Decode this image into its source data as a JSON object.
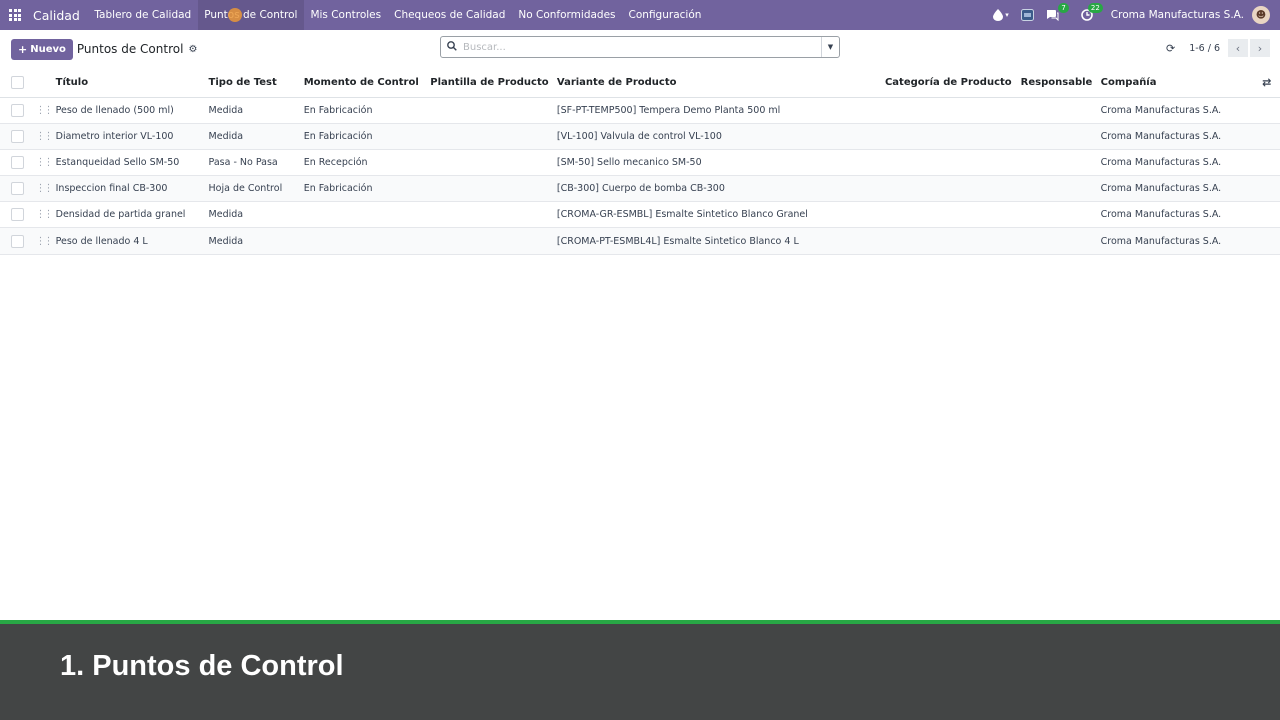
{
  "navbar": {
    "brand": "Calidad",
    "menu": [
      {
        "label": "Tablero de Calidad",
        "active": false
      },
      {
        "label": "Puntos de Control",
        "active": true
      },
      {
        "label": "Mis Controles",
        "active": false
      },
      {
        "label": "Chequeos de Calidad",
        "active": false
      },
      {
        "label": "No Conformidades",
        "active": false
      },
      {
        "label": "Configuración",
        "active": false
      }
    ],
    "messages_badge": "7",
    "activities_badge": "22",
    "company": "Croma Manufacturas S.A.",
    "color": "#71639e"
  },
  "control_panel": {
    "new_label": "Nuevo",
    "title": "Puntos de Control",
    "search_placeholder": "Buscar...",
    "pager": "1-6 / 6"
  },
  "table": {
    "columns": [
      "Título",
      "Tipo de Test",
      "Momento de Control",
      "Plantilla de Producto",
      "Variante de Producto",
      "Categoría de Producto",
      "Responsable",
      "Compañía"
    ],
    "rows": [
      [
        "Peso de llenado (500 ml)",
        "Medida",
        "En Fabricación",
        "",
        "[SF-PT-TEMP500] Tempera Demo Planta 500 ml",
        "",
        "",
        "Croma Manufacturas S.A."
      ],
      [
        "Diametro interior VL-100",
        "Medida",
        "En Fabricación",
        "",
        "[VL-100] Valvula de control VL-100",
        "",
        "",
        "Croma Manufacturas S.A."
      ],
      [
        "Estanqueidad Sello SM-50",
        "Pasa - No Pasa",
        "En Recepción",
        "",
        "[SM-50] Sello mecanico SM-50",
        "",
        "",
        "Croma Manufacturas S.A."
      ],
      [
        "Inspeccion final CB-300",
        "Hoja de Control",
        "En Fabricación",
        "",
        "[CB-300] Cuerpo de bomba CB-300",
        "",
        "",
        "Croma Manufacturas S.A."
      ],
      [
        "Densidad de partida granel",
        "Medida",
        "",
        "",
        "[CROMA-GR-ESMBL] Esmalte Sintetico Blanco Granel",
        "",
        "",
        "Croma Manufacturas S.A."
      ],
      [
        "Peso de llenado 4 L",
        "Medida",
        "",
        "",
        "[CROMA-PT-ESMBL4L] Esmalte Sintetico Blanco 4 L",
        "",
        "",
        "Croma Manufacturas S.A."
      ]
    ]
  },
  "banner": {
    "title": "1. Puntos de Control",
    "accent": "#28a745",
    "background": "#434545"
  }
}
